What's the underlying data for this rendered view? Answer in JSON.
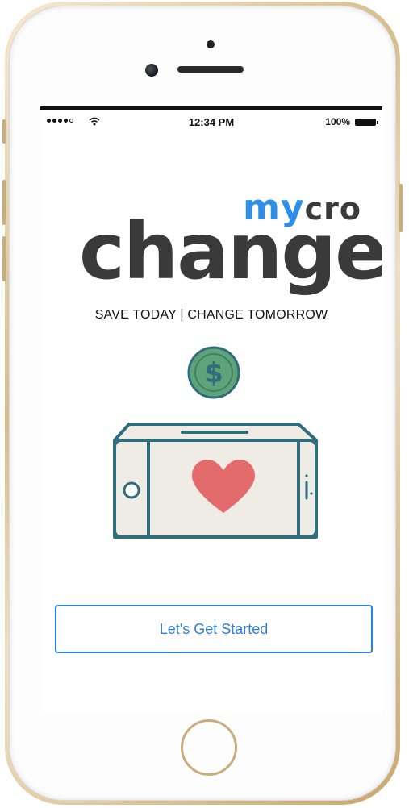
{
  "status_bar": {
    "time": "12:34 PM",
    "battery_percent": "100%",
    "signal_bars": 4,
    "signal_max": 5
  },
  "logo": {
    "my": "my",
    "cro": "cro",
    "change": "change"
  },
  "tagline": "SAVE TODAY | CHANGE TOMORROW",
  "illustration": {
    "coin_symbol": "$"
  },
  "cta": {
    "label": "Let's Get Started"
  },
  "colors": {
    "accent_blue": "#2f8fe6",
    "logo_dark": "#3a3a3a",
    "button_blue": "#2f7fd6",
    "coin_green": "#5fa37a",
    "heart_red": "#e46b6b",
    "device_teal": "#2f6e7c",
    "device_fill": "#efebe5",
    "frame_gold": "#d8bd8b"
  },
  "icons": {
    "signal": "signal-dots-icon",
    "wifi": "wifi-icon",
    "battery": "battery-icon",
    "coin": "dollar-coin-icon",
    "heart": "heart-icon",
    "device": "phone-landscape-icon"
  }
}
